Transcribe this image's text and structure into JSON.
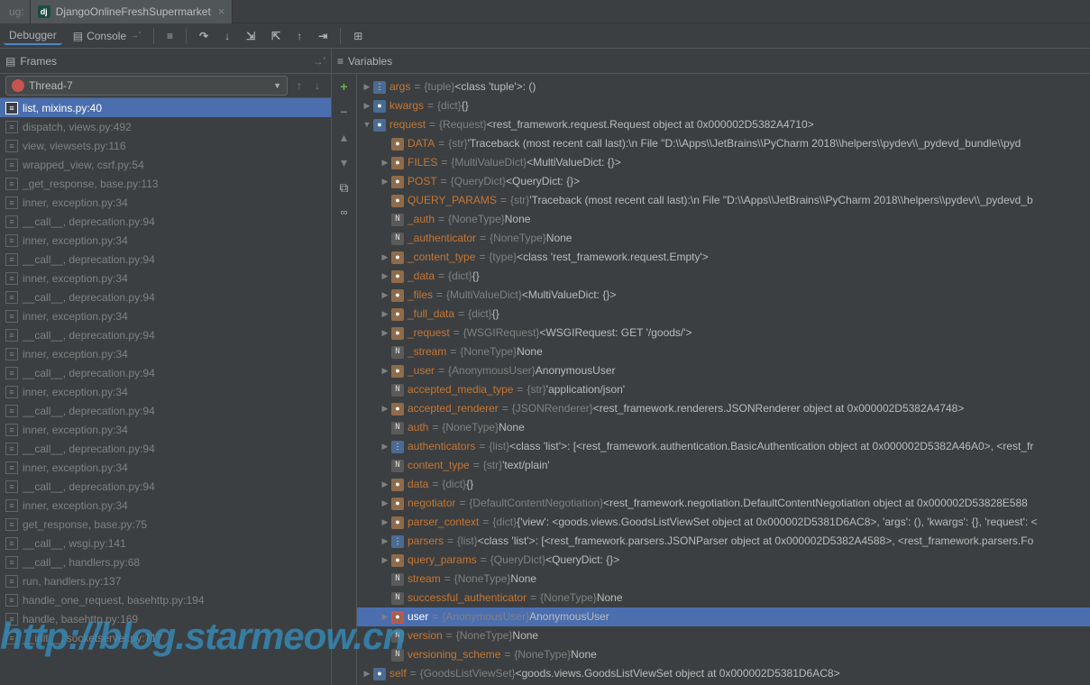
{
  "title_bar": {
    "prefix": "ug:",
    "tab_name": "DjangoOnlineFreshSupermarket"
  },
  "toolbar": {
    "debugger": "Debugger",
    "console": "Console",
    "console_arrow": "→'"
  },
  "frames": {
    "header": "Frames",
    "thread": "Thread-7",
    "items": [
      {
        "label": "list, mixins.py:40",
        "selected": true
      },
      {
        "label": "dispatch, views.py:492"
      },
      {
        "label": "view, viewsets.py:116"
      },
      {
        "label": "wrapped_view, csrf.py:54"
      },
      {
        "label": "_get_response, base.py:113"
      },
      {
        "label": "inner, exception.py:34"
      },
      {
        "label": "__call__, deprecation.py:94"
      },
      {
        "label": "inner, exception.py:34"
      },
      {
        "label": "__call__, deprecation.py:94"
      },
      {
        "label": "inner, exception.py:34"
      },
      {
        "label": "__call__, deprecation.py:94"
      },
      {
        "label": "inner, exception.py:34"
      },
      {
        "label": "__call__, deprecation.py:94"
      },
      {
        "label": "inner, exception.py:34"
      },
      {
        "label": "__call__, deprecation.py:94"
      },
      {
        "label": "inner, exception.py:34"
      },
      {
        "label": "__call__, deprecation.py:94"
      },
      {
        "label": "inner, exception.py:34"
      },
      {
        "label": "__call__, deprecation.py:94"
      },
      {
        "label": "inner, exception.py:34"
      },
      {
        "label": "__call__, deprecation.py:94"
      },
      {
        "label": "inner, exception.py:34"
      },
      {
        "label": "get_response, base.py:75"
      },
      {
        "label": "__call__, wsgi.py:141"
      },
      {
        "label": "__call__, handlers.py:68"
      },
      {
        "label": "run, handlers.py:137"
      },
      {
        "label": "handle_one_request, basehttp.py:194"
      },
      {
        "label": "handle, basehttp.py:169"
      },
      {
        "label": "__init__, socketserver.py:717"
      }
    ]
  },
  "variables": {
    "header": "Variables",
    "tree": [
      {
        "d": 0,
        "t": "closed",
        "i": "list",
        "n": "args",
        "eq": " = ",
        "ty": "{tuple}",
        "v": " <class 'tuple'>: ()"
      },
      {
        "d": 0,
        "t": "closed",
        "i": "obj",
        "n": "kwargs",
        "eq": " = ",
        "ty": "{dict}",
        "v": " {}"
      },
      {
        "d": 0,
        "t": "open",
        "i": "obj",
        "n": "request",
        "eq": " = ",
        "ty": "{Request}",
        "v": " <rest_framework.request.Request object at 0x000002D5382A4710>"
      },
      {
        "d": 1,
        "t": "none",
        "i": "field",
        "n": "DATA",
        "eq": " = ",
        "ty": "{str}",
        "v": " 'Traceback (most recent call last):\\n  File \"D:\\\\Apps\\\\JetBrains\\\\PyCharm 2018\\\\helpers\\\\pydev\\\\_pydevd_bundle\\\\pyd"
      },
      {
        "d": 1,
        "t": "closed",
        "i": "field",
        "n": "FILES",
        "eq": " = ",
        "ty": "{MultiValueDict}",
        "v": " <MultiValueDict: {}>"
      },
      {
        "d": 1,
        "t": "closed",
        "i": "field",
        "n": "POST",
        "eq": " = ",
        "ty": "{QueryDict}",
        "v": " <QueryDict: {}>"
      },
      {
        "d": 1,
        "t": "none",
        "i": "field",
        "n": "QUERY_PARAMS",
        "eq": " = ",
        "ty": "{str}",
        "v": " 'Traceback (most recent call last):\\n  File \"D:\\\\Apps\\\\JetBrains\\\\PyCharm 2018\\\\helpers\\\\pydev\\\\_pydevd_b"
      },
      {
        "d": 1,
        "t": "none",
        "i": "none",
        "n": "_auth",
        "eq": " = ",
        "ty": "{NoneType}",
        "v": " None"
      },
      {
        "d": 1,
        "t": "none",
        "i": "none",
        "n": "_authenticator",
        "eq": " = ",
        "ty": "{NoneType}",
        "v": " None"
      },
      {
        "d": 1,
        "t": "closed",
        "i": "field",
        "n": "_content_type",
        "eq": " = ",
        "ty": "{type}",
        "v": " <class 'rest_framework.request.Empty'>"
      },
      {
        "d": 1,
        "t": "closed",
        "i": "field",
        "n": "_data",
        "eq": " = ",
        "ty": "{dict}",
        "v": " {}"
      },
      {
        "d": 1,
        "t": "closed",
        "i": "field",
        "n": "_files",
        "eq": " = ",
        "ty": "{MultiValueDict}",
        "v": " <MultiValueDict: {}>"
      },
      {
        "d": 1,
        "t": "closed",
        "i": "field",
        "n": "_full_data",
        "eq": " = ",
        "ty": "{dict}",
        "v": " {}"
      },
      {
        "d": 1,
        "t": "closed",
        "i": "field",
        "n": "_request",
        "eq": " = ",
        "ty": "{WSGIRequest}",
        "v": " <WSGIRequest: GET '/goods/'>"
      },
      {
        "d": 1,
        "t": "none",
        "i": "none",
        "n": "_stream",
        "eq": " = ",
        "ty": "{NoneType}",
        "v": " None"
      },
      {
        "d": 1,
        "t": "closed",
        "i": "field",
        "n": "_user",
        "eq": " = ",
        "ty": "{AnonymousUser}",
        "v": " AnonymousUser"
      },
      {
        "d": 1,
        "t": "none",
        "i": "none",
        "n": "accepted_media_type",
        "eq": " = ",
        "ty": "{str}",
        "v": " 'application/json'"
      },
      {
        "d": 1,
        "t": "closed",
        "i": "field",
        "n": "accepted_renderer",
        "eq": " = ",
        "ty": "{JSONRenderer}",
        "v": " <rest_framework.renderers.JSONRenderer object at 0x000002D5382A4748>"
      },
      {
        "d": 1,
        "t": "none",
        "i": "none",
        "n": "auth",
        "eq": " = ",
        "ty": "{NoneType}",
        "v": " None"
      },
      {
        "d": 1,
        "t": "closed",
        "i": "list",
        "n": "authenticators",
        "eq": " = ",
        "ty": "{list}",
        "v": " <class 'list'>: [<rest_framework.authentication.BasicAuthentication object at 0x000002D5382A46A0>, <rest_fr"
      },
      {
        "d": 1,
        "t": "none",
        "i": "none",
        "n": "content_type",
        "eq": " = ",
        "ty": "{str}",
        "v": " 'text/plain'"
      },
      {
        "d": 1,
        "t": "closed",
        "i": "field",
        "n": "data",
        "eq": " = ",
        "ty": "{dict}",
        "v": " {}"
      },
      {
        "d": 1,
        "t": "closed",
        "i": "field",
        "n": "negotiator",
        "eq": " = ",
        "ty": "{DefaultContentNegotiation}",
        "v": " <rest_framework.negotiation.DefaultContentNegotiation object at 0x000002D53828E588"
      },
      {
        "d": 1,
        "t": "closed",
        "i": "field",
        "n": "parser_context",
        "eq": " = ",
        "ty": "{dict}",
        "v": " {'view': <goods.views.GoodsListViewSet object at 0x000002D5381D6AC8>, 'args': (), 'kwargs': {}, 'request': <"
      },
      {
        "d": 1,
        "t": "closed",
        "i": "list",
        "n": "parsers",
        "eq": " = ",
        "ty": "{list}",
        "v": " <class 'list'>: [<rest_framework.parsers.JSONParser object at 0x000002D5382A4588>, <rest_framework.parsers.Fo"
      },
      {
        "d": 1,
        "t": "closed",
        "i": "field",
        "n": "query_params",
        "eq": " = ",
        "ty": "{QueryDict}",
        "v": " <QueryDict: {}>"
      },
      {
        "d": 1,
        "t": "none",
        "i": "none",
        "n": "stream",
        "eq": " = ",
        "ty": "{NoneType}",
        "v": " None"
      },
      {
        "d": 1,
        "t": "none",
        "i": "none",
        "n": "successful_authenticator",
        "eq": " = ",
        "ty": "{NoneType}",
        "v": " None"
      },
      {
        "d": 1,
        "t": "closed",
        "i": "field",
        "n": "user",
        "eq": " = ",
        "ty": "{AnonymousUser}",
        "v": " AnonymousUser",
        "selected": true,
        "red": true
      },
      {
        "d": 1,
        "t": "none",
        "i": "none",
        "n": "version",
        "eq": " = ",
        "ty": "{NoneType}",
        "v": " None"
      },
      {
        "d": 1,
        "t": "none",
        "i": "none",
        "n": "versioning_scheme",
        "eq": " = ",
        "ty": "{NoneType}",
        "v": " None"
      },
      {
        "d": 0,
        "t": "closed",
        "i": "obj",
        "n": "self",
        "eq": " = ",
        "ty": "{GoodsListViewSet}",
        "v": " <goods.views.GoodsListViewSet object at 0x000002D5381D6AC8>"
      }
    ]
  },
  "watermark": "http://blog.starmeow.cn"
}
